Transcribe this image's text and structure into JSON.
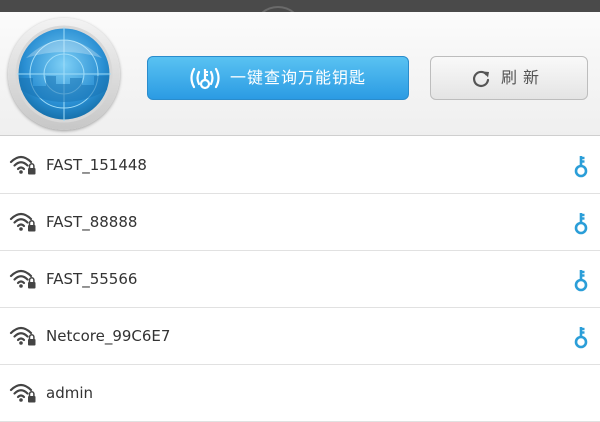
{
  "header": {
    "query_button_label": "一键查询万能钥匙",
    "refresh_button_label": "刷新"
  },
  "networks": [
    {
      "ssid": "FAST_151448",
      "has_key": true
    },
    {
      "ssid": "FAST_88888",
      "has_key": true
    },
    {
      "ssid": "FAST_55566",
      "has_key": true
    },
    {
      "ssid": "Netcore_99C6E7",
      "has_key": true
    },
    {
      "ssid": "admin",
      "has_key": false
    }
  ],
  "colors": {
    "accent_blue": "#2b9be3",
    "key_blue": "#2b9ed8",
    "text": "#333333"
  },
  "icons": {
    "radar": "radar-icon",
    "query": "wifi-key-icon",
    "refresh": "refresh-icon",
    "wifi": "wifi-locked-icon",
    "key": "key-icon"
  }
}
